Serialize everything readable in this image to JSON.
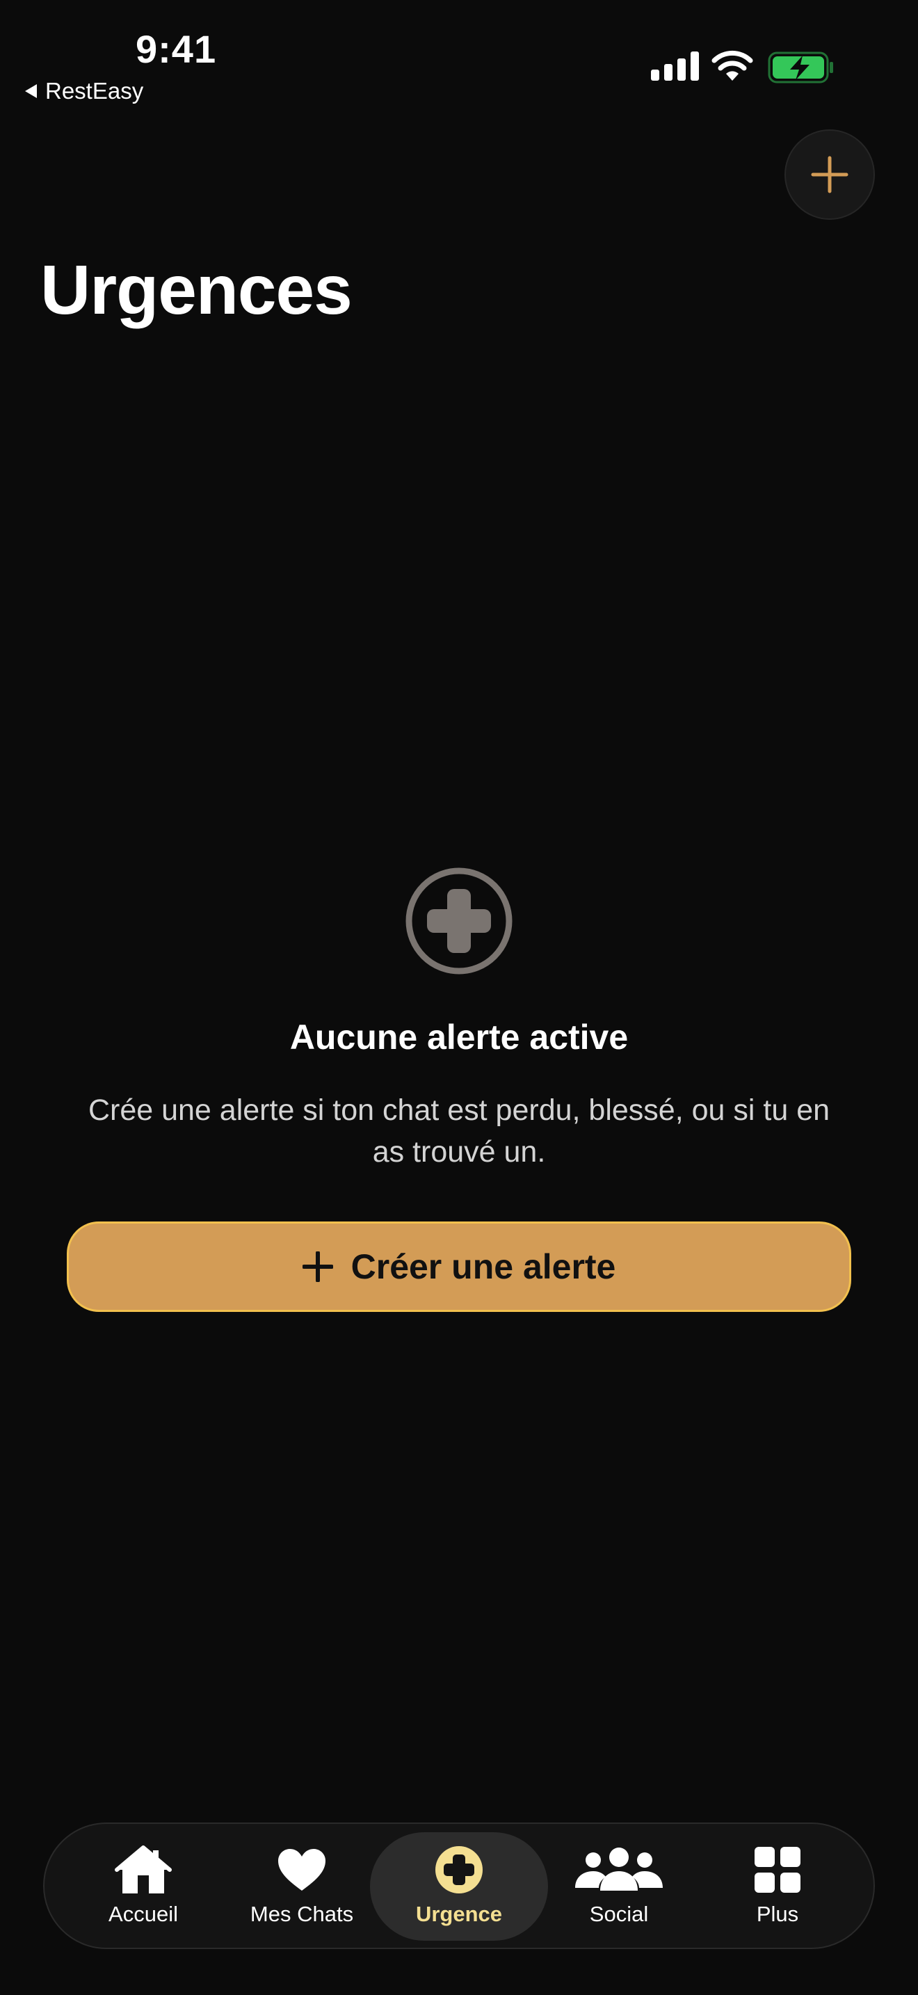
{
  "status_bar": {
    "time": "9:41",
    "back_app_label": "RestEasy"
  },
  "header": {
    "add_button_icon": "plus-icon",
    "title": "Urgences"
  },
  "empty_state": {
    "icon": "medical-cross-icon",
    "title": "Aucune alerte active",
    "description": "Crée une alerte si ton chat est perdu, blessé, ou si tu en as trouvé un.",
    "create_button_label": "Créer une alerte"
  },
  "tab_bar": {
    "items": [
      {
        "label": "Accueil",
        "icon": "home-icon",
        "active": false
      },
      {
        "label": "Mes Chats",
        "icon": "heart-icon",
        "active": false
      },
      {
        "label": "Urgence",
        "icon": "medical-cross-icon",
        "active": true
      },
      {
        "label": "Social",
        "icon": "people-icon",
        "active": false
      },
      {
        "label": "Plus",
        "icon": "grid-icon",
        "active": false
      }
    ]
  },
  "colors": {
    "background": "#0b0b0b",
    "accent": "#d39c56",
    "accent_border": "#f2c04e",
    "active_tab_text": "#f4df92",
    "battery_green": "#34c759"
  }
}
